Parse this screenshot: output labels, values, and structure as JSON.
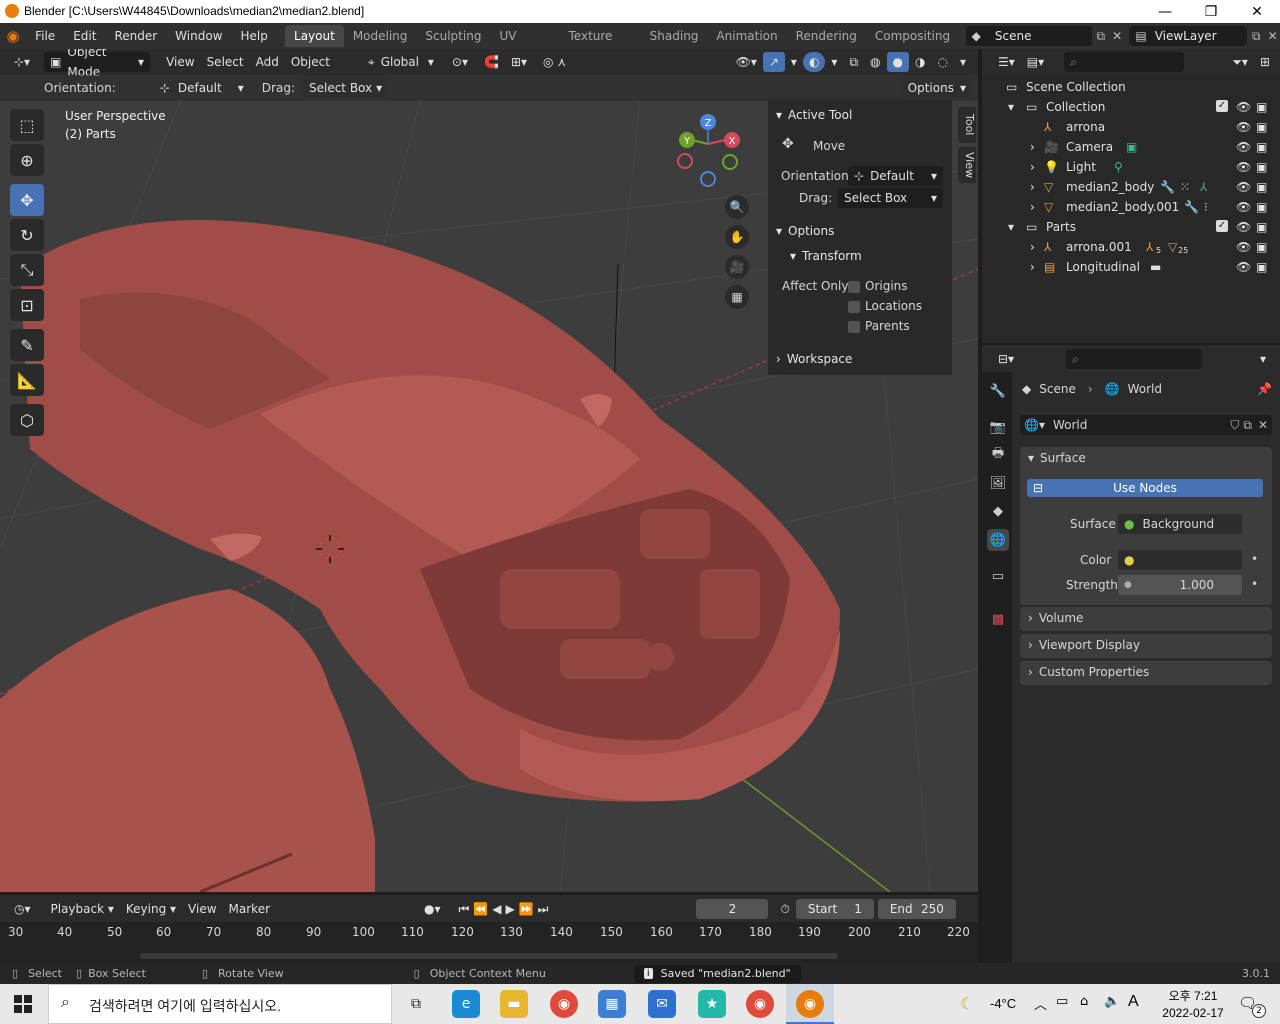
{
  "window": {
    "title": "Blender [C:\\Users\\W44845\\Downloads\\median2\\median2.blend]",
    "minimize": "—",
    "maximize": "❐",
    "close": "✕"
  },
  "menubar": {
    "items": [
      "File",
      "Edit",
      "Render",
      "Window",
      "Help"
    ],
    "workspaces": [
      "Layout",
      "Modeling",
      "Sculpting",
      "UV Editing",
      "Texture Paint",
      "Shading",
      "Animation",
      "Rendering",
      "Compositing"
    ],
    "active_workspace": "Layout",
    "scene": "Scene",
    "view_layer": "ViewLayer"
  },
  "viewport": {
    "mode": "Object Mode",
    "menus": [
      "View",
      "Select",
      "Add",
      "Object"
    ],
    "transform_orientation": "Global",
    "orientation_label": "Orientation:",
    "orientation_value": "Default",
    "drag_label": "Drag:",
    "drag_value": "Select Box",
    "options": "Options",
    "overlay_title": "User Perspective",
    "overlay_subtitle": "(2) Parts",
    "gizmo": {
      "x": "X",
      "y": "Y",
      "z": "Z"
    },
    "side_tabs": [
      "Tool",
      "View"
    ]
  },
  "npanel": {
    "active_tool": "Active Tool",
    "tool_name": "Move",
    "orientation_label": "Orientation",
    "orientation_value": "Default",
    "drag_label": "Drag:",
    "drag_value": "Select Box",
    "options": "Options",
    "transform": "Transform",
    "affect_only": "Affect Only",
    "affect_items": [
      "Origins",
      "Locations",
      "Parents"
    ],
    "workspace": "Workspace"
  },
  "outliner": {
    "root": "Scene Collection",
    "rows": [
      {
        "name": "Collection",
        "indent": 1
      },
      {
        "name": "arrona",
        "indent": 2
      },
      {
        "name": "Camera",
        "indent": 2
      },
      {
        "name": "Light",
        "indent": 2
      },
      {
        "name": "median2_body",
        "indent": 2
      },
      {
        "name": "median2_body.001",
        "indent": 2
      },
      {
        "name": "Parts",
        "indent": 1
      },
      {
        "name": "arrona.001",
        "indent": 2
      },
      {
        "name": "Longitudinal",
        "indent": 2
      }
    ],
    "badge_5": "5",
    "badge_25": "25"
  },
  "properties": {
    "breadcrumb_scene": "Scene",
    "breadcrumb_world": "World",
    "world_name": "World",
    "surface_panel": "Surface",
    "use_nodes": "Use Nodes",
    "surface_label": "Surface",
    "surface_value": "Background",
    "color_label": "Color",
    "strength_label": "Strength",
    "strength_value": "1.000",
    "collapsed_panels": [
      "Volume",
      "Viewport Display",
      "Custom Properties"
    ]
  },
  "timeline": {
    "menus": [
      "Playback",
      "Keying",
      "View",
      "Marker"
    ],
    "current_frame": "2",
    "start_label": "Start",
    "start_value": "1",
    "end_label": "End",
    "end_value": "250",
    "ticks": [
      "30",
      "40",
      "50",
      "60",
      "70",
      "80",
      "90",
      "100",
      "110",
      "120",
      "130",
      "140",
      "150",
      "160",
      "170",
      "180",
      "190",
      "200",
      "210",
      "220"
    ]
  },
  "statusbar": {
    "select": "Select",
    "box_select": "Box Select",
    "rotate_view": "Rotate View",
    "context_menu": "Object Context Menu",
    "saved_message": "Saved \"median2.blend\"",
    "version": "3.0.1"
  },
  "taskbar": {
    "search_placeholder": "검색하려면 여기에 입력하십시오.",
    "weather": "-4°C",
    "ime": "A",
    "time": "오후 7:21",
    "date": "2022-02-17",
    "notifications": "2"
  },
  "colors": {
    "accent": "#4772b3",
    "model": "#a8524c",
    "background": "#3d3d3d"
  }
}
